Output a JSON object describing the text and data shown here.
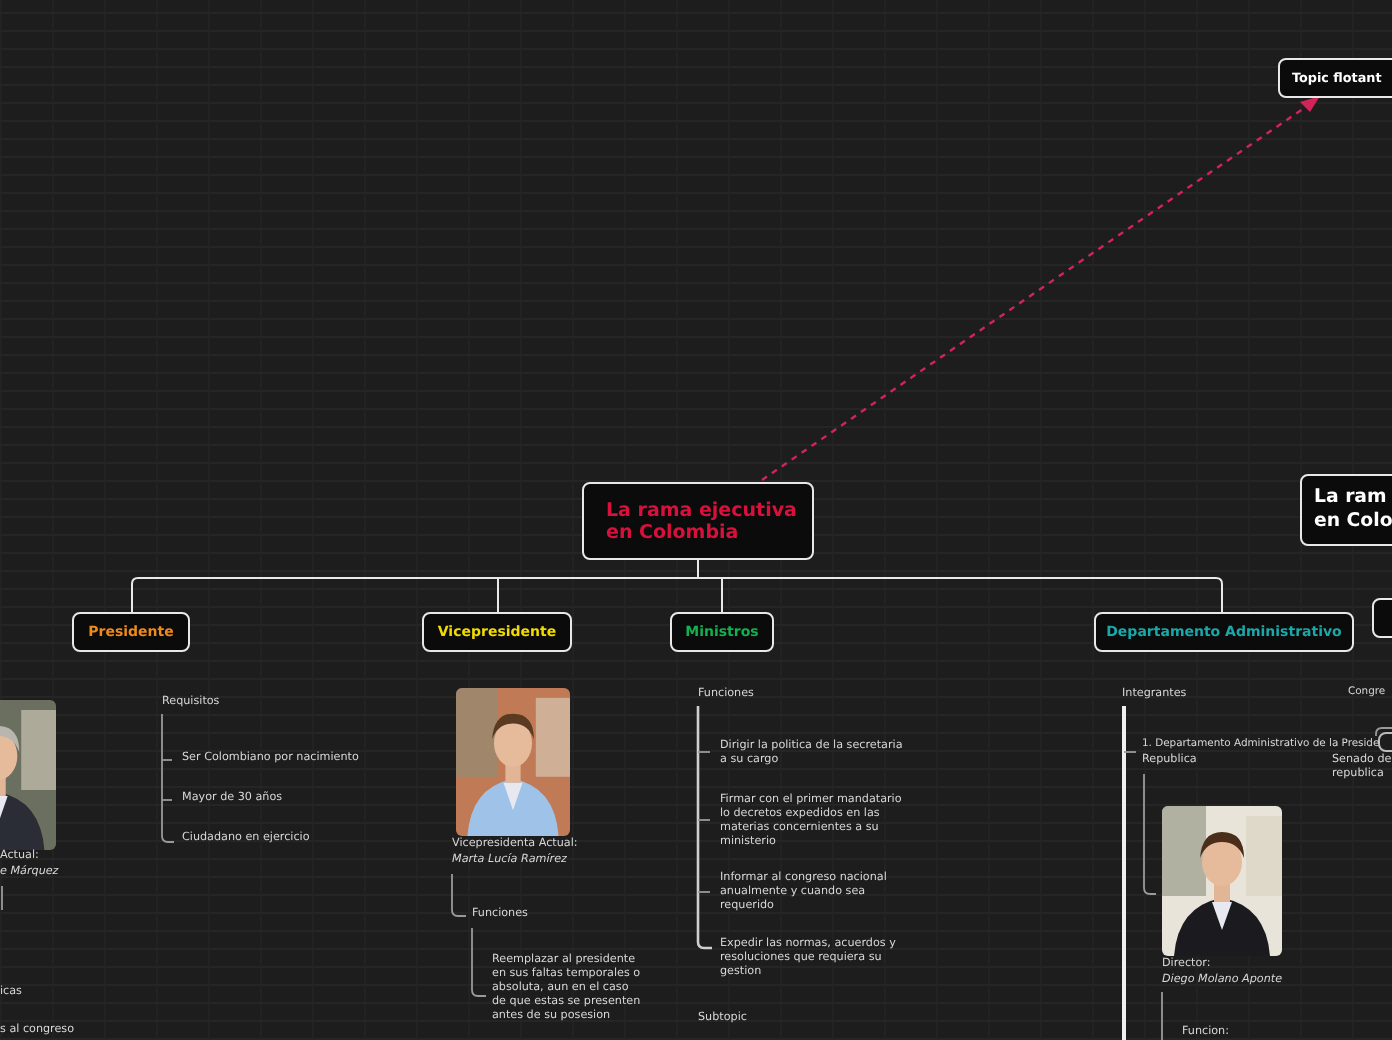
{
  "floating_topic": "Topic flotant",
  "central_topic": {
    "lines": [
      "La rama ejecutiva",
      "en Colombia"
    ]
  },
  "edge_topic": {
    "lines": [
      "La ram",
      "en Colo"
    ]
  },
  "branches": [
    {
      "label": "Presidente",
      "color": "#ee8a1c"
    },
    {
      "label": "Vicepresidente",
      "color": "#f2dc00"
    },
    {
      "label": "Ministros",
      "color": "#12b04e"
    },
    {
      "label": "Departamento Administrativo",
      "color": "#1aa8a8"
    }
  ],
  "notes": [
    {
      "kind": "plain",
      "lines": [
        "Requisitos"
      ]
    },
    {
      "kind": "plain",
      "lines": [
        "Ser Colombiano por nacimiento"
      ]
    },
    {
      "kind": "plain",
      "lines": [
        "Mayor de 30 años"
      ]
    },
    {
      "kind": "plain",
      "lines": [
        "Ciudadano en ejercicio"
      ]
    },
    {
      "kind": "plain",
      "lines": [
        "Actual:"
      ]
    },
    {
      "kind": "italic",
      "lines": [
        "e Márquez"
      ]
    },
    {
      "kind": "plain",
      "lines": [
        "icas"
      ]
    },
    {
      "kind": "plain",
      "lines": [
        "s al congreso"
      ]
    },
    {
      "kind": "plain",
      "lines": [
        "Vicepresidenta Actual:"
      ]
    },
    {
      "kind": "italic",
      "lines": [
        "Marta Lucía Ramírez"
      ]
    },
    {
      "kind": "plain",
      "lines": [
        "Funciones"
      ]
    },
    {
      "kind": "plain",
      "lines": [
        "Reemplazar al presidente",
        "en sus faltas temporales o",
        "absoluta, aun en el caso",
        "de que estas se presenten",
        "antes de su posesion"
      ]
    },
    {
      "kind": "plain",
      "lines": [
        "Funciones"
      ]
    },
    {
      "kind": "plain",
      "lines": [
        "Dirigir la politica de la secretaria",
        "a su cargo"
      ]
    },
    {
      "kind": "plain",
      "lines": [
        "Firmar con el primer mandatario",
        "lo decretos expedidos en las",
        "materias concernientes a su",
        "ministerio"
      ]
    },
    {
      "kind": "plain",
      "lines": [
        "Informar al congreso nacional",
        "anualmente y cuando sea",
        "requerido"
      ]
    },
    {
      "kind": "plain",
      "lines": [
        "Expedir las normas, acuerdos y",
        "resoluciones que requiera su",
        "gestion"
      ]
    },
    {
      "kind": "plain",
      "lines": [
        "Subtopic"
      ]
    },
    {
      "kind": "plain",
      "lines": [
        "Integrantes"
      ]
    },
    {
      "kind": "plain",
      "lines": [
        "1. Departamento Administrativo de la Preside"
      ]
    },
    {
      "kind": "plain",
      "lines": [
        "Republica"
      ]
    },
    {
      "kind": "plain",
      "lines": [
        "Director:"
      ]
    },
    {
      "kind": "italic",
      "lines": [
        "Diego Molano Aponte"
      ]
    },
    {
      "kind": "plain",
      "lines": [
        "Funcion:"
      ]
    },
    {
      "kind": "plain",
      "lines": [
        "Congre"
      ]
    },
    {
      "kind": "plain",
      "lines": [
        "Senado de",
        "republica"
      ]
    }
  ]
}
